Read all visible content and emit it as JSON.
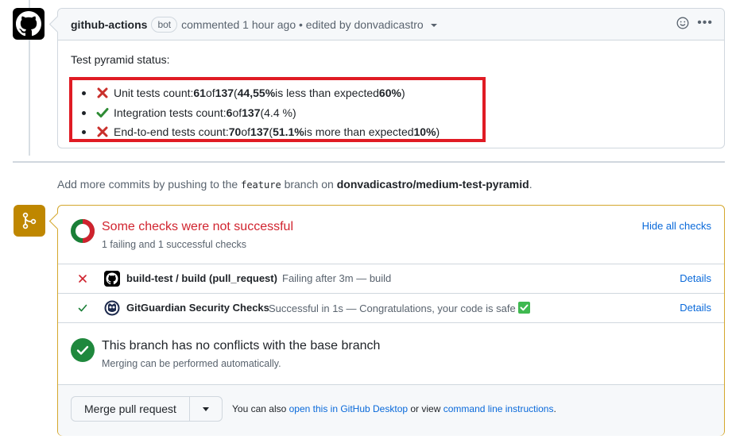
{
  "comment": {
    "author": "github-actions",
    "badge": "bot",
    "action": "commented 1 hour ago • edited by donvadicastro",
    "title": "Test pyramid status:",
    "items": [
      {
        "status": "fail",
        "label": "Unit tests count: ",
        "count": "61",
        "of": " of ",
        "total": "137",
        "open": " (",
        "pct": "44,55%",
        "note": " is less than expected ",
        "expected": "60%",
        "close": ")"
      },
      {
        "status": "pass",
        "label": "Integration tests count: ",
        "count": "6",
        "of": " of ",
        "total": "137",
        "rest": " (4.4 %)"
      },
      {
        "status": "fail",
        "label": "End-to-end tests count: ",
        "count": "70",
        "of": " of ",
        "total": "137",
        "open": " (",
        "pct": "51.1%",
        "note": " is more than expected ",
        "expected": "10%",
        "close": ")"
      }
    ]
  },
  "hint": {
    "prefix": "Add more commits by pushing to the ",
    "branch": "feature",
    "mid": " branch on ",
    "repo": "donvadicastro/medium-test-pyramid",
    "suffix": "."
  },
  "checks": {
    "title": "Some checks were not successful",
    "subtitle": "1 failing and 1 successful checks",
    "hide_label": "Hide all checks",
    "rows": [
      {
        "status": "fail",
        "name": "build-test / build (pull_request)",
        "desc": "Failing after 3m — build",
        "details": "Details"
      },
      {
        "status": "pass",
        "name": "GitGuardian Security Checks",
        "desc": "Successful in 1s — Congratulations, your code is safe ",
        "details": "Details"
      }
    ]
  },
  "conflicts": {
    "title": "This branch has no conflicts with the base branch",
    "subtitle": "Merging can be performed automatically."
  },
  "merge": {
    "button": "Merge pull request",
    "hint_prefix": "You can also ",
    "desktop_link": "open this in GitHub Desktop",
    "hint_mid": " or view ",
    "cli_link": "command line instructions",
    "hint_suffix": "."
  },
  "colors": {
    "fail": "#d1242f",
    "success": "#1a7f37",
    "attention": "#bf8700",
    "link": "#0969da"
  }
}
